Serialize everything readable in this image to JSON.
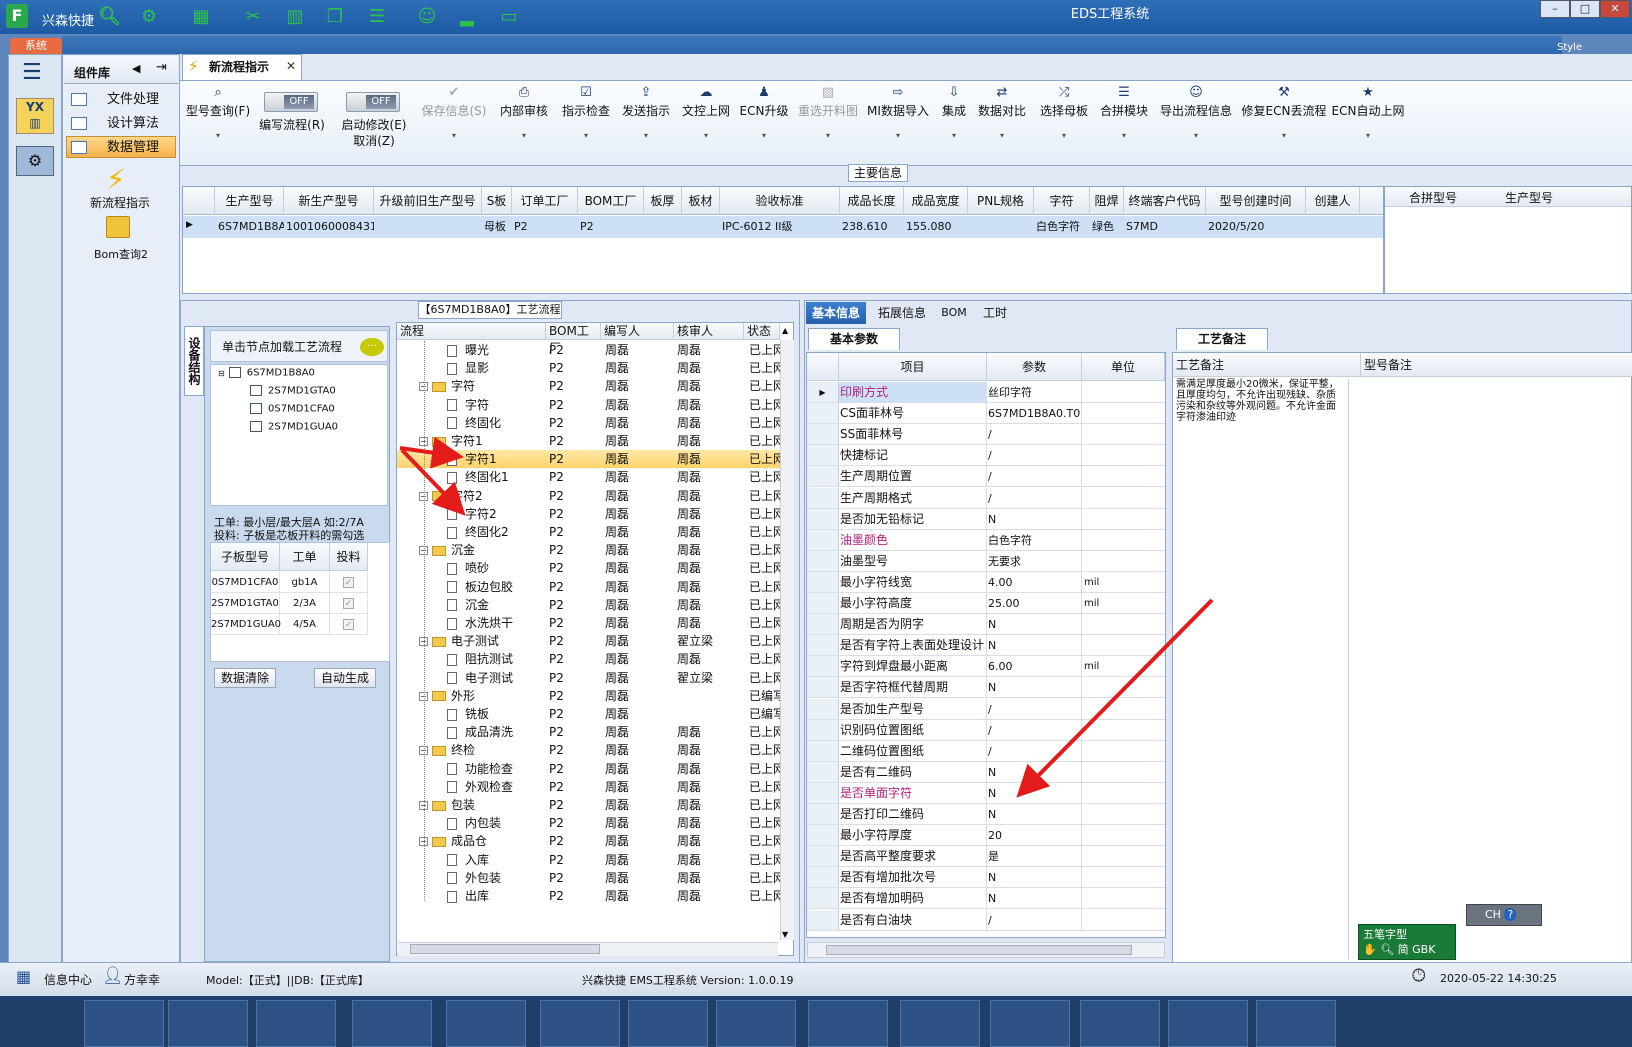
{
  "app": {
    "name": "兴森快捷",
    "window_title": "EDS工程系统",
    "system_tab": "系统",
    "style_label": "Style",
    "logo_letter": "F"
  },
  "rail": {
    "icon1_text": "YX"
  },
  "component_library": {
    "title": "组件库",
    "items": [
      "文件处理",
      "设计算法",
      "数据管理"
    ],
    "selected": "数据管理",
    "shortcuts": [
      "新流程指示",
      "Bom查询2"
    ]
  },
  "tab": {
    "label": "新流程指示"
  },
  "ribbon": {
    "buttons": [
      {
        "label": "型号查询(F)",
        "icon": "search-icon",
        "enabled": true
      },
      {
        "label": "编写流程(R)",
        "icon": "toggle",
        "toggle": "OFF",
        "enabled": true
      },
      {
        "label": "启动修改(E)",
        "label2": "取消(Z)",
        "icon": "toggle",
        "toggle": "OFF",
        "enabled": true
      },
      {
        "label": "保存信息(S)",
        "icon": "check-icon",
        "enabled": false
      },
      {
        "label": "内部审核",
        "icon": "print-icon",
        "enabled": true
      },
      {
        "label": "指示检查",
        "icon": "checklist-icon",
        "enabled": true
      },
      {
        "label": "发送指示",
        "icon": "upload-icon",
        "enabled": true
      },
      {
        "label": "文控上网",
        "icon": "cloud-icon",
        "enabled": true
      },
      {
        "label": "ECN升级",
        "icon": "people-icon",
        "enabled": true
      },
      {
        "label": "重选开料图",
        "icon": "image-icon",
        "enabled": false
      },
      {
        "label": "MI数据导入",
        "icon": "import-icon",
        "enabled": true
      },
      {
        "label": "集成",
        "icon": "download-icon",
        "enabled": true
      },
      {
        "label": "数据对比",
        "icon": "compare-icon",
        "enabled": true
      },
      {
        "label": "选择母板",
        "icon": "shuffle-icon",
        "enabled": true
      },
      {
        "label": "合拼模块",
        "icon": "list-icon",
        "enabled": true
      },
      {
        "label": "导出流程信息",
        "icon": "smile-icon",
        "enabled": true
      },
      {
        "label": "修复ECN丢流程",
        "icon": "wrench-icon",
        "enabled": true
      },
      {
        "label": "ECN自动上网",
        "icon": "star-icon",
        "enabled": true
      }
    ]
  },
  "main_info": {
    "label": "主要信息",
    "columns": [
      "生产型号",
      "新生产型号",
      "升级前旧生产型号",
      "S板",
      "订单工厂",
      "BOM工厂",
      "板厚",
      "板材",
      "验收标准",
      "成品长度",
      "成品宽度",
      "PNL规格",
      "字符",
      "阻焊",
      "终端客户代码",
      "型号创建时间",
      "创建人"
    ],
    "rows": [
      [
        "6S7MD1B8A0",
        "10010600084315",
        "",
        "母板",
        "P2",
        "P2",
        "",
        "",
        "IPC-6012 II级",
        "238.610",
        "155.080",
        "",
        "白色字符",
        "绿色",
        "S7MD",
        "2020/5/20",
        ""
      ]
    ],
    "side_columns": [
      "合拼型号",
      "生产型号"
    ]
  },
  "flow_panel": {
    "title": "【6S7MD1B8A0】工艺流程",
    "vertical_tab": "设备结构",
    "hint": "单击节点加载工艺流程",
    "tree": {
      "root": "6S7MD1B8A0",
      "children": [
        "2S7MD1GTA0",
        "0S7MD1CFA0",
        "2S7MD1GUA0"
      ]
    },
    "note1": "工单: 最小层/最大层A 如:2/7A",
    "note2": "投料: 子板是芯板开料的需勾选",
    "sub_columns": [
      "子板型号",
      "工单",
      "投料"
    ],
    "sub_rows": [
      [
        "0S7MD1CFA0",
        "gb1A",
        "✓"
      ],
      [
        "2S7MD1GTA0",
        "2/3A",
        "✓"
      ],
      [
        "2S7MD1GUA0",
        "4/5A",
        "✓"
      ]
    ],
    "btn_clear": "数据清除",
    "btn_auto": "自动生成"
  },
  "process_grid": {
    "columns": [
      "流程",
      "BOM工厂",
      "编写人",
      "核审人",
      "状态"
    ],
    "rows": [
      {
        "name": "曝光",
        "level": 2,
        "folder": false,
        "bom": "P2",
        "writer": "周磊",
        "reviewer": "周磊",
        "status": "已上网"
      },
      {
        "name": "显影",
        "level": 2,
        "folder": false,
        "bom": "P2",
        "writer": "周磊",
        "reviewer": "周磊",
        "status": "已上网"
      },
      {
        "name": "字符",
        "level": 1,
        "folder": true,
        "bom": "P2",
        "writer": "周磊",
        "reviewer": "周磊",
        "status": "已上网"
      },
      {
        "name": "字符",
        "level": 2,
        "folder": false,
        "bom": "P2",
        "writer": "周磊",
        "reviewer": "周磊",
        "status": "已上网"
      },
      {
        "name": "终固化",
        "level": 2,
        "folder": false,
        "bom": "P2",
        "writer": "周磊",
        "reviewer": "周磊",
        "status": "已上网"
      },
      {
        "name": "字符1",
        "level": 1,
        "folder": true,
        "bom": "P2",
        "writer": "周磊",
        "reviewer": "周磊",
        "status": "已上网"
      },
      {
        "name": "字符1",
        "level": 2,
        "folder": false,
        "bom": "P2",
        "writer": "周磊",
        "reviewer": "周磊",
        "status": "已上网",
        "selected": true
      },
      {
        "name": "终固化1",
        "level": 2,
        "folder": false,
        "bom": "P2",
        "writer": "周磊",
        "reviewer": "周磊",
        "status": "已上网"
      },
      {
        "name": "字符2",
        "level": 1,
        "folder": true,
        "bom": "P2",
        "writer": "周磊",
        "reviewer": "周磊",
        "status": "已上网"
      },
      {
        "name": "字符2",
        "level": 2,
        "folder": false,
        "bom": "P2",
        "writer": "周磊",
        "reviewer": "周磊",
        "status": "已上网"
      },
      {
        "name": "终固化2",
        "level": 2,
        "folder": false,
        "bom": "P2",
        "writer": "周磊",
        "reviewer": "周磊",
        "status": "已上网"
      },
      {
        "name": "沉金",
        "level": 1,
        "folder": true,
        "bom": "P2",
        "writer": "周磊",
        "reviewer": "周磊",
        "status": "已上网"
      },
      {
        "name": "喷砂",
        "level": 2,
        "folder": false,
        "bom": "P2",
        "writer": "周磊",
        "reviewer": "周磊",
        "status": "已上网"
      },
      {
        "name": "板边包胶",
        "level": 2,
        "folder": false,
        "bom": "P2",
        "writer": "周磊",
        "reviewer": "周磊",
        "status": "已上网"
      },
      {
        "name": "沉金",
        "level": 2,
        "folder": false,
        "bom": "P2",
        "writer": "周磊",
        "reviewer": "周磊",
        "status": "已上网"
      },
      {
        "name": "水洗烘干",
        "level": 2,
        "folder": false,
        "bom": "P2",
        "writer": "周磊",
        "reviewer": "周磊",
        "status": "已上网"
      },
      {
        "name": "电子测试",
        "level": 1,
        "folder": true,
        "bom": "P2",
        "writer": "周磊",
        "reviewer": "翟立梁",
        "status": "已上网"
      },
      {
        "name": "阻抗测试",
        "level": 2,
        "folder": false,
        "bom": "P2",
        "writer": "周磊",
        "reviewer": "周磊",
        "status": "已上网"
      },
      {
        "name": "电子测试",
        "level": 2,
        "folder": false,
        "bom": "P2",
        "writer": "周磊",
        "reviewer": "翟立梁",
        "status": "已上网"
      },
      {
        "name": "外形",
        "level": 1,
        "folder": true,
        "bom": "P2",
        "writer": "周磊",
        "reviewer": "",
        "status": "已编写"
      },
      {
        "name": "铣板",
        "level": 2,
        "folder": false,
        "bom": "P2",
        "writer": "周磊",
        "reviewer": "",
        "status": "已编写"
      },
      {
        "name": "成品清洗",
        "level": 2,
        "folder": false,
        "bom": "P2",
        "writer": "周磊",
        "reviewer": "周磊",
        "status": "已上网"
      },
      {
        "name": "终检",
        "level": 1,
        "folder": true,
        "bom": "P2",
        "writer": "周磊",
        "reviewer": "周磊",
        "status": "已上网"
      },
      {
        "name": "功能检查",
        "level": 2,
        "folder": false,
        "bom": "P2",
        "writer": "周磊",
        "reviewer": "周磊",
        "status": "已上网"
      },
      {
        "name": "外观检查",
        "level": 2,
        "folder": false,
        "bom": "P2",
        "writer": "周磊",
        "reviewer": "周磊",
        "status": "已上网"
      },
      {
        "name": "包装",
        "level": 1,
        "folder": true,
        "bom": "P2",
        "writer": "周磊",
        "reviewer": "周磊",
        "status": "已上网"
      },
      {
        "name": "内包装",
        "level": 2,
        "folder": false,
        "bom": "P2",
        "writer": "周磊",
        "reviewer": "周磊",
        "status": "已上网"
      },
      {
        "name": "成品仓",
        "level": 1,
        "folder": true,
        "bom": "P2",
        "writer": "周磊",
        "reviewer": "周磊",
        "status": "已上网"
      },
      {
        "name": "入库",
        "level": 2,
        "folder": false,
        "bom": "P2",
        "writer": "周磊",
        "reviewer": "周磊",
        "status": "已上网"
      },
      {
        "name": "外包装",
        "level": 2,
        "folder": false,
        "bom": "P2",
        "writer": "周磊",
        "reviewer": "周磊",
        "status": "已上网"
      },
      {
        "name": "出库",
        "level": 2,
        "folder": false,
        "bom": "P2",
        "writer": "周磊",
        "reviewer": "周磊",
        "status": "已上网"
      }
    ]
  },
  "right_tabs": [
    "基本信息",
    "拓展信息",
    "BOM",
    "工时"
  ],
  "params": {
    "tab": "基本参数",
    "columns": [
      "项目",
      "参数",
      "单位"
    ],
    "rows": [
      {
        "item": "印刷方式",
        "value": "丝印字符",
        "unit": "",
        "pink": true
      },
      {
        "item": "CS面菲林号",
        "value": "6S7MD1B8A0.T01",
        "unit": ""
      },
      {
        "item": "SS面菲林号",
        "value": "/",
        "unit": ""
      },
      {
        "item": "快捷标记",
        "value": "/",
        "unit": ""
      },
      {
        "item": "生产周期位置",
        "value": "/",
        "unit": ""
      },
      {
        "item": "生产周期格式",
        "value": "/",
        "unit": ""
      },
      {
        "item": "是否加无铅标记",
        "value": "N",
        "unit": ""
      },
      {
        "item": "油墨颜色",
        "value": "白色字符",
        "unit": "",
        "pink": true
      },
      {
        "item": "油墨型号",
        "value": "无要求",
        "unit": ""
      },
      {
        "item": "最小字符线宽",
        "value": "4.00",
        "unit": "mil"
      },
      {
        "item": "最小字符高度",
        "value": "25.00",
        "unit": "mil"
      },
      {
        "item": "周期是否为阴字",
        "value": "N",
        "unit": ""
      },
      {
        "item": "是否有字符上表面处理设计",
        "value": "N",
        "unit": ""
      },
      {
        "item": "字符到焊盘最小距离",
        "value": "6.00",
        "unit": "mil"
      },
      {
        "item": "是否字符框代替周期",
        "value": "N",
        "unit": ""
      },
      {
        "item": "是否加生产型号",
        "value": "/",
        "unit": ""
      },
      {
        "item": "识别码位置图纸",
        "value": "/",
        "unit": ""
      },
      {
        "item": "二维码位置图纸",
        "value": "/",
        "unit": ""
      },
      {
        "item": "是否有二维码",
        "value": "N",
        "unit": ""
      },
      {
        "item": "是否单面字符",
        "value": "N",
        "unit": "",
        "pink": true
      },
      {
        "item": "是否打印二维码",
        "value": "N",
        "unit": ""
      },
      {
        "item": "最小字符厚度",
        "value": "20",
        "unit": ""
      },
      {
        "item": "是否高平整度要求",
        "value": "是",
        "unit": ""
      },
      {
        "item": "是否有增加批次号",
        "value": "N",
        "unit": ""
      },
      {
        "item": "是否有增加明码",
        "value": "N",
        "unit": ""
      },
      {
        "item": "是否有白油块",
        "value": "/",
        "unit": ""
      }
    ]
  },
  "remark": {
    "tab": "工艺备注",
    "col1": "工艺备注",
    "col2": "型号备注",
    "text": "需满足厚度最小20微米，保证平整，且厚度均匀，不允许出现残缺、杂质污染和杂纹等外观问题。不允许金面字符渗油印迹"
  },
  "ime": {
    "line1": "CH",
    "mode": "五笔字型",
    "line2": "简 GBK"
  },
  "status": {
    "info_center": "信息中心",
    "user": "方幸幸",
    "model": "Model:【正式】||DB:【正式库】",
    "version": "兴森快捷 EMS工程系统 Version: 1.0.0.19",
    "datetime": "2020-05-22 14:30:25"
  }
}
